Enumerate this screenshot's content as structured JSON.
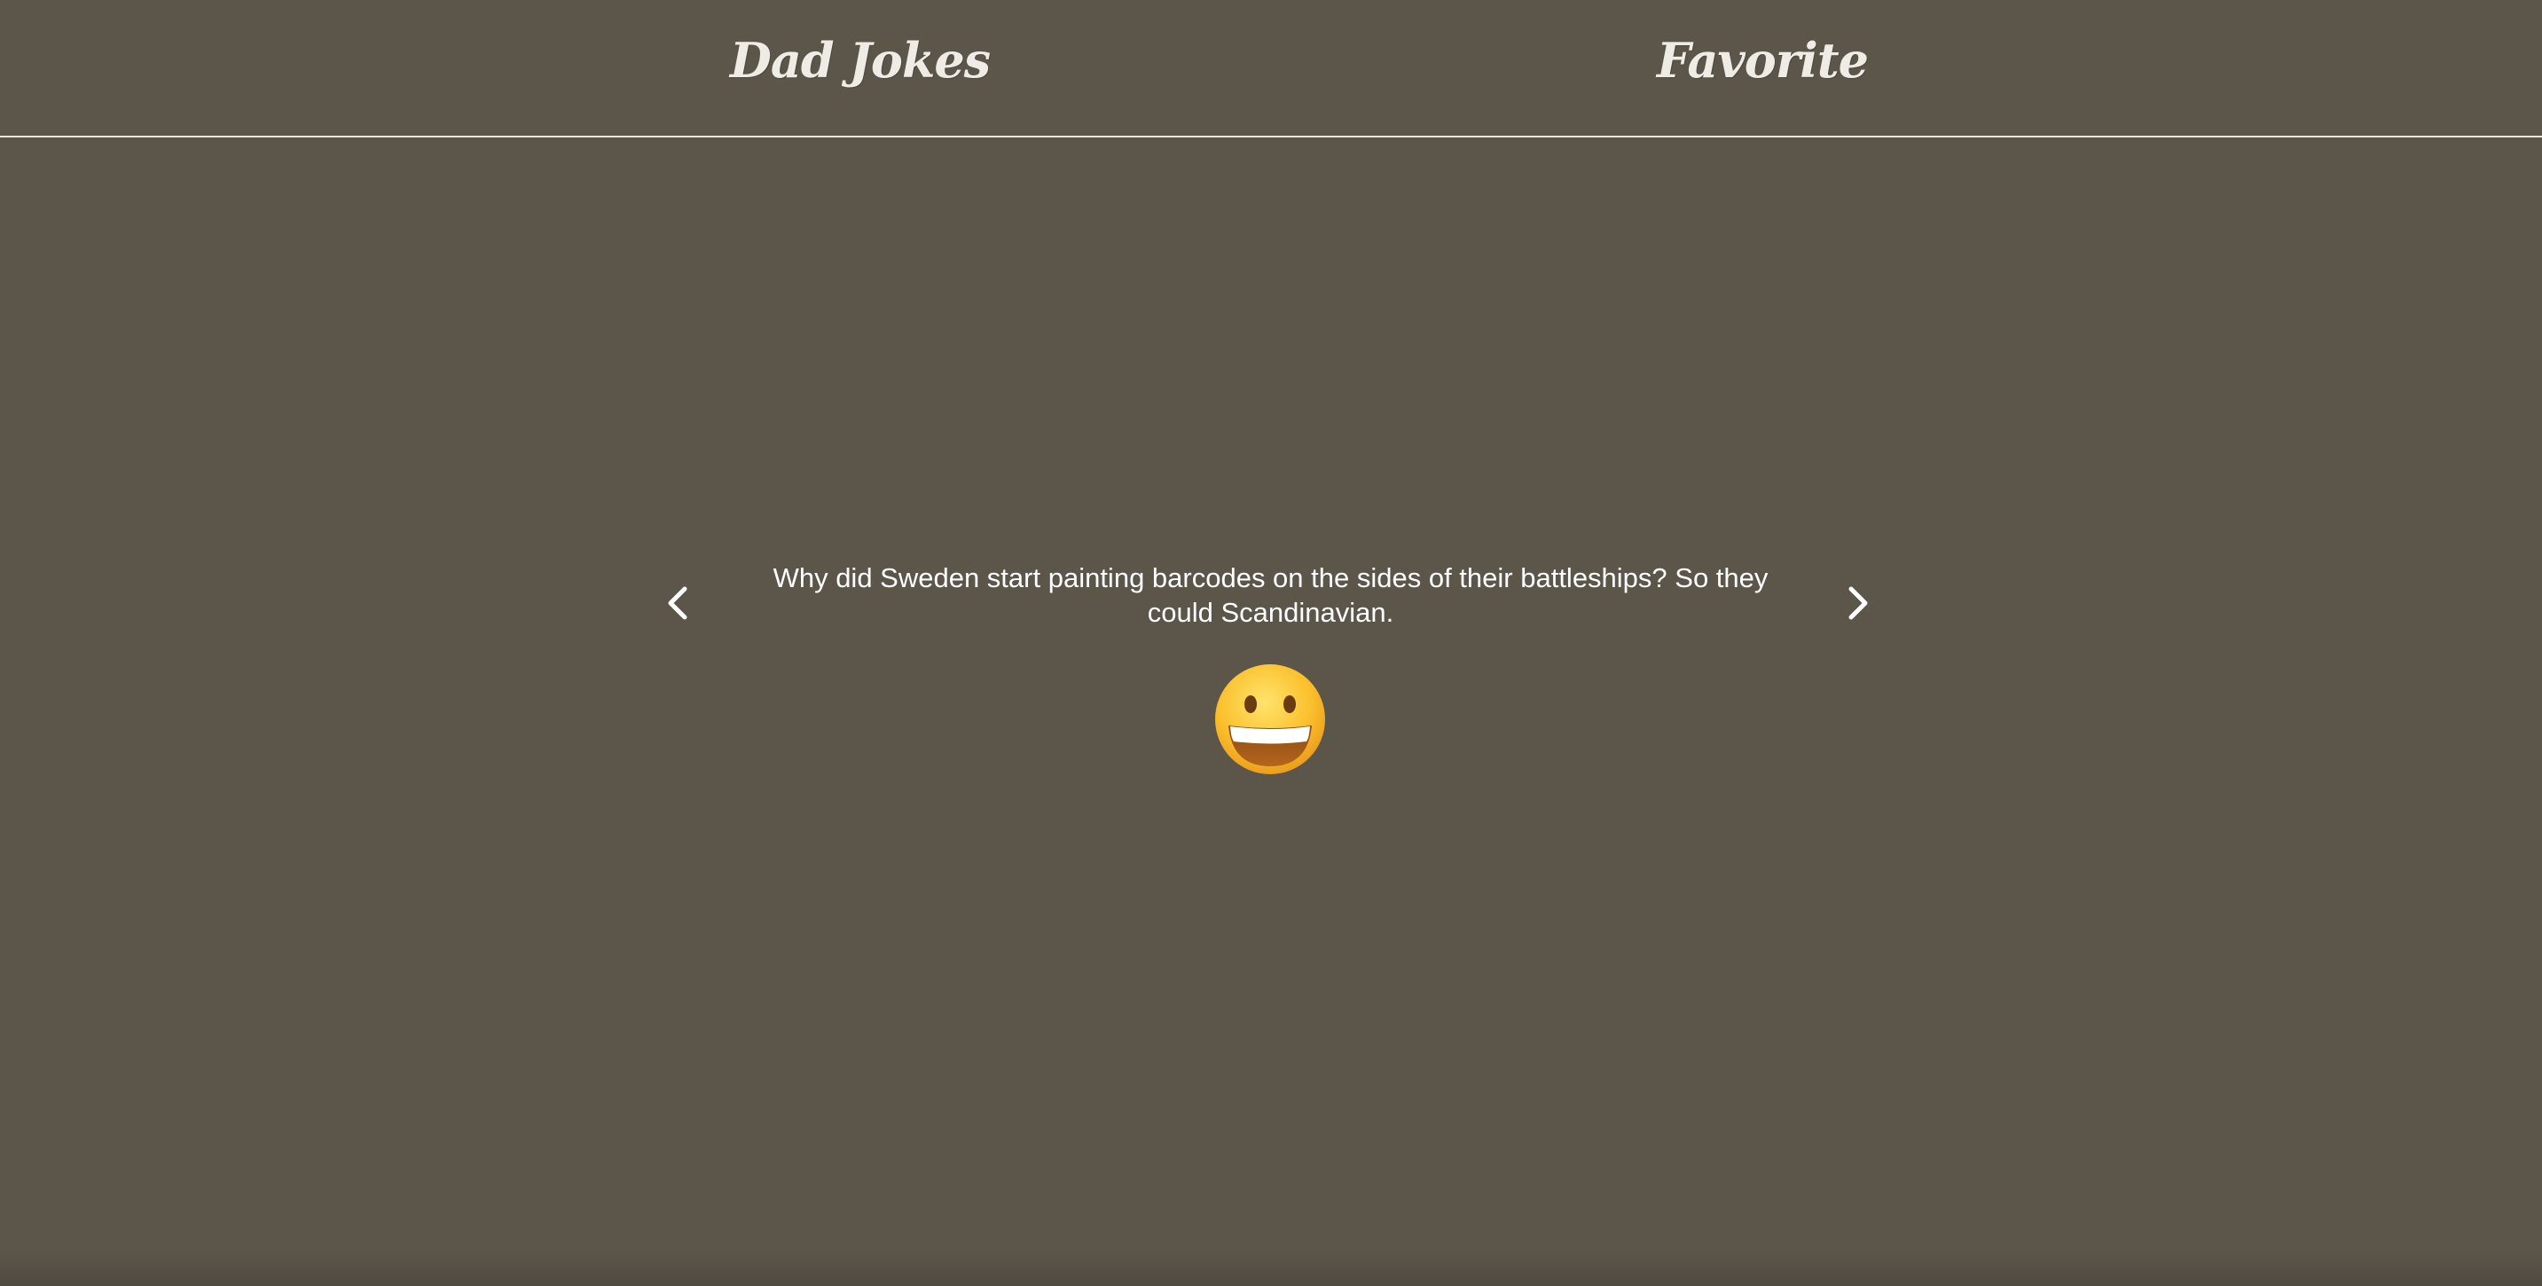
{
  "nav": {
    "dad_jokes_label": "Dad Jokes",
    "favorite_label": "Favorite"
  },
  "joke": {
    "text": "Why did Sweden start painting barcodes on the sides of their battleships? So they could Scandinavian.",
    "reaction_icon": "grinning-face-emoji"
  },
  "carousel": {
    "prev_icon": "chevron-left-icon",
    "next_icon": "chevron-right-icon"
  },
  "colors": {
    "background": "#5b554a",
    "text": "#ffffff",
    "nav_text": "#efece6",
    "divider": "#e9e6df"
  }
}
